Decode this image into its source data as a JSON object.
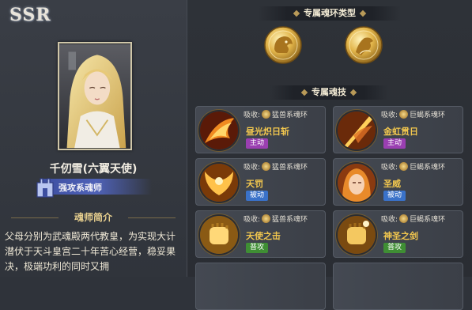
{
  "rarity": "SSR",
  "character": {
    "name": "千仞雪(六翼天使)",
    "role": "强攻系魂师"
  },
  "intro": {
    "title": "魂师简介",
    "text": "父母分别为武魂殿两代教皇，为实现大计潜伏于天斗皇宫二十年苦心经营，稳妥果决，极端功利的同时又拥"
  },
  "soul_ring_types": {
    "title": "专属魂环类型",
    "emblems": [
      "lion-emblem-icon",
      "horse-emblem-icon"
    ]
  },
  "soul_skills": {
    "title": "专属魂技",
    "absorb_label": "吸收:",
    "cards": [
      {
        "absorb": "猛兽系魂环",
        "name": "昼光炽日斩",
        "tag": "主动",
        "tag_type": "active",
        "icon": "flame-slash-icon"
      },
      {
        "absorb": "巨蝎系魂环",
        "name": "金虹贯日",
        "tag": "主动",
        "tag_type": "active",
        "icon": "golden-spear-icon"
      },
      {
        "absorb": "猛兽系魂环",
        "name": "天罚",
        "tag": "被动",
        "tag_type": "passive",
        "icon": "golden-wings-icon"
      },
      {
        "absorb": "巨蝎系魂环",
        "name": "圣威",
        "tag": "被动",
        "tag_type": "passive",
        "icon": "angel-face-icon"
      },
      {
        "absorb": "猛兽系魂环",
        "name": "天使之击",
        "tag": "普攻",
        "tag_type": "normal",
        "icon": "golden-fist-icon"
      },
      {
        "absorb": "巨蝎系魂环",
        "name": "神圣之剑",
        "tag": "普攻",
        "tag_type": "normal",
        "icon": "holy-fist-icon"
      }
    ]
  },
  "colors": {
    "skill_name": "#f2c74e",
    "tag_active": "#9a3fb1",
    "tag_passive": "#3a72c9",
    "tag_normal": "#3f8e34",
    "role_banner": "#4f62b8"
  }
}
